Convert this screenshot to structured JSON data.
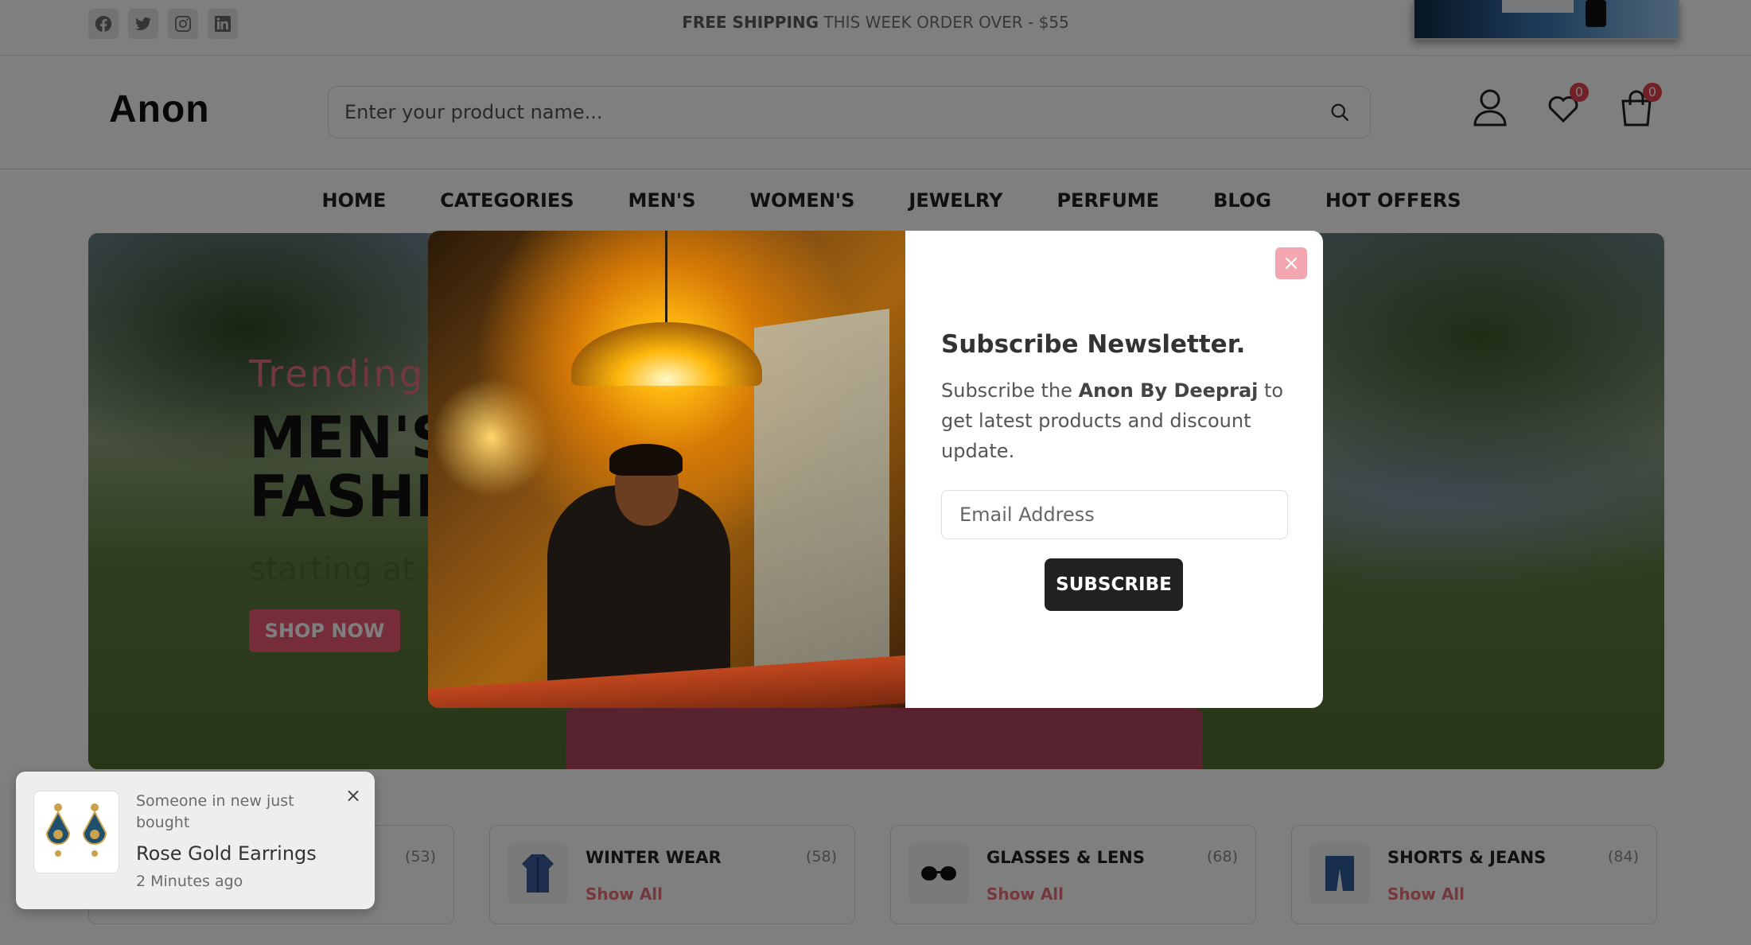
{
  "topbar": {
    "social": [
      "facebook-icon",
      "twitter-icon",
      "instagram-icon",
      "linkedin-icon"
    ],
    "shipping_bold": "FREE SHIPPING",
    "shipping_rest": " THIS WEEK ORDER OVER - $55"
  },
  "header": {
    "logo": "Anon",
    "search_placeholder": "Enter your product name...",
    "wishlist_count": "0",
    "cart_count": "0"
  },
  "nav": [
    "HOME",
    "CATEGORIES",
    "MEN'S",
    "WOMEN'S",
    "JEWELRY",
    "PERFUME",
    "BLOG",
    "HOT OFFERS"
  ],
  "banner": {
    "subtitle": "Trending",
    "title_line1": "MEN'S",
    "title_line2": "FASHIO",
    "price": "starting at $",
    "button": "SHOP NOW"
  },
  "categories": [
    {
      "name": "",
      "count": "(53)",
      "link": ""
    },
    {
      "name": "WINTER WEAR",
      "count": "(58)",
      "link": "Show All"
    },
    {
      "name": "GLASSES & LENS",
      "count": "(68)",
      "link": "Show All"
    },
    {
      "name": "SHORTS & JEANS",
      "count": "(84)",
      "link": "Show All"
    }
  ],
  "modal": {
    "close_label": "×",
    "title": "Subscribe Newsletter.",
    "text_prefix": "Subscribe the ",
    "text_brand": "Anon By Deepraj",
    "text_suffix": " to get latest products and discount update.",
    "email_placeholder": "Email Address",
    "button": "SUBSCRIBE"
  },
  "toast": {
    "line1": "Someone in new just bought",
    "title": "Rose Gold Earrings",
    "time": "2 Minutes ago",
    "close": "×"
  },
  "colors": {
    "accent": "#e5707d",
    "dark": "#212121",
    "badge": "#e5434f"
  }
}
